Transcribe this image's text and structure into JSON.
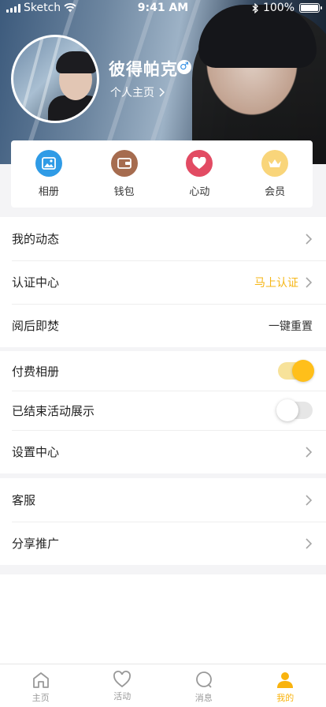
{
  "status_bar": {
    "carrier": "Sketch",
    "time": "9:41 AM",
    "battery": "100%"
  },
  "profile": {
    "name": "彼得帕克",
    "gender_symbol": "♂",
    "homepage_link": "个人主页"
  },
  "quick_actions": [
    {
      "label": "相册",
      "icon": "album-icon",
      "color": "#2f9be6"
    },
    {
      "label": "钱包",
      "icon": "wallet-icon",
      "color": "#a66c4f"
    },
    {
      "label": "心动",
      "icon": "heart-icon",
      "color": "#e24b63"
    },
    {
      "label": "会员",
      "icon": "crown-icon",
      "color": "#f9d57a"
    }
  ],
  "menu": {
    "group1": [
      {
        "label": "我的动态"
      },
      {
        "label": "认证中心",
        "value": "马上认证",
        "value_color": "#f6b615"
      },
      {
        "label": "阅后即焚",
        "value": "一键重置"
      }
    ],
    "group2": [
      {
        "label": "付费相册",
        "toggle": true
      },
      {
        "label": "已结束活动展示",
        "toggle": false
      },
      {
        "label": "设置中心"
      }
    ],
    "group3": [
      {
        "label": "客服"
      },
      {
        "label": "分享推广"
      }
    ]
  },
  "tabbar": {
    "items": [
      {
        "label": "主页",
        "icon": "home-icon"
      },
      {
        "label": "活动",
        "icon": "heart-outline-icon"
      },
      {
        "label": "消息",
        "icon": "message-icon"
      },
      {
        "label": "我的",
        "icon": "person-icon",
        "active": true
      }
    ],
    "active_color": "#f9b30e"
  }
}
